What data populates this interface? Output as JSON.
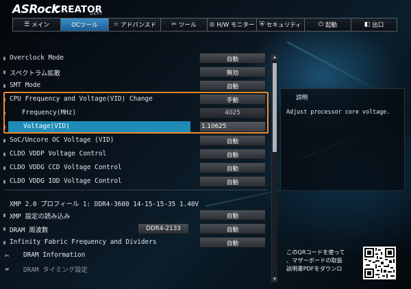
{
  "brand": {
    "name": "ASRock",
    "series": "CREATOR",
    "sub": "UEFI"
  },
  "tabs": [
    {
      "icon": "☰",
      "label": "メイン",
      "active": false
    },
    {
      "icon": "",
      "label": "OCツール",
      "active": true
    },
    {
      "icon": "☆",
      "label": "アドバンスド",
      "active": false
    },
    {
      "icon": "✂",
      "label": "ツール",
      "active": false
    },
    {
      "icon": "◎",
      "label": "H/W モニター",
      "active": false
    },
    {
      "icon": "⛨",
      "label": "セキュリティ",
      "active": false
    },
    {
      "icon": "⏻",
      "label": "起動",
      "active": false
    },
    {
      "icon": "◧",
      "label": "出口",
      "active": false
    }
  ],
  "settings": {
    "overclock_mode": {
      "label": "Overclock Mode",
      "value": "自動"
    },
    "spread_spectrum": {
      "label": "スペクトラム拡散",
      "value": "無効"
    },
    "smt_mode": {
      "label": "SMT Mode",
      "value": "自動"
    },
    "cpu_freq_voltage": {
      "label": "CPU Frequency and Voltage(VID) Change",
      "value": "手動"
    },
    "frequency": {
      "label": "Frequency(MHz)",
      "value": "4025"
    },
    "voltage": {
      "label": "Voltage(VID)",
      "value": "1.10625"
    },
    "soc_uncore": {
      "label": "SoC/Uncore OC Voltage (VID)",
      "value": "自動"
    },
    "cldo_vddp": {
      "label": "CLDO VDDP Voltage Control",
      "value": "自動"
    },
    "cldo_vddg_ccd": {
      "label": "CLDO VDDG CCD Voltage Control",
      "value": "自動"
    },
    "cldo_vddg_iod": {
      "label": "CLDO VDDG IOD Voltage Control",
      "value": "自動"
    },
    "xmp_profile": {
      "label": "XMP 2.0 プロフィール 1: DDR4-3600 14-15-15-35 1.40V"
    },
    "xmp_load": {
      "label": "XMP 設定の読み込み",
      "value": "自動"
    },
    "dram_freq": {
      "label": "DRAM 周波数",
      "midvalue": "DDR4-2133",
      "value": "自動"
    },
    "infinity_fabric": {
      "label": "Infinity Fabric Frequency and Dividers",
      "value": "自動"
    },
    "dram_info": {
      "label": "DRAM Information"
    },
    "dram_timing": {
      "label": "DRAM タイミング設定"
    }
  },
  "description": {
    "title": "説明",
    "body": "Adjust processor core voltage."
  },
  "qr": {
    "line1": "このQRコードを使って",
    "line2": "、マザーボードの取扱",
    "line3": "説明書PDFをダウンロ"
  },
  "colors": {
    "selection": "#1f8bb8",
    "highlight_box": "#f08a2b",
    "active_tab": "#2f7fb8"
  }
}
